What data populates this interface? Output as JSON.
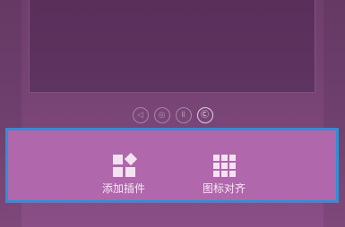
{
  "pager": {
    "dots": [
      "◁",
      "◎",
      "Ⅱ",
      "Ⓒ"
    ],
    "active_index": 3
  },
  "toolbar": {
    "add_widget": {
      "label": "添加插件",
      "icon": "widgets-icon"
    },
    "align_icons": {
      "label": "图标对齐",
      "icon": "grid-icon"
    }
  },
  "colors": {
    "accent": "#2f8fd6",
    "toolbar_bg": "#b067ac",
    "background": "#6e3e6c"
  }
}
